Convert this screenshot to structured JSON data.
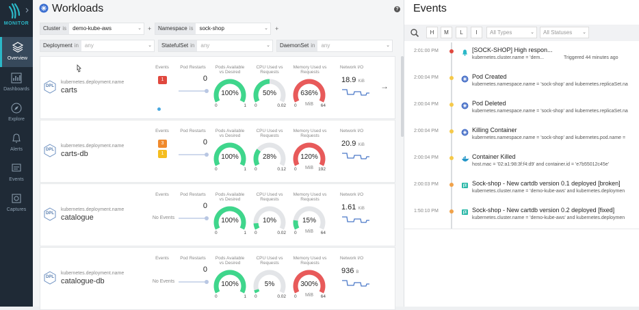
{
  "brand": {
    "label": "MONITOR",
    "accent": "#2bb8c8"
  },
  "sidebar": {
    "items": [
      {
        "label": "Overview",
        "icon": "layers-icon"
      },
      {
        "label": "Dashboards",
        "icon": "dashboard-icon"
      },
      {
        "label": "Explore",
        "icon": "compass-icon"
      },
      {
        "label": "Alerts",
        "icon": "bell-icon"
      },
      {
        "label": "Events",
        "icon": "events-icon"
      },
      {
        "label": "Captures",
        "icon": "capture-icon"
      }
    ]
  },
  "workloads": {
    "title": "Workloads",
    "help": "?",
    "filters": {
      "cluster": {
        "key": "Cluster",
        "op": "is",
        "value": "demo-kube-aws"
      },
      "namespace": {
        "key": "Namespace",
        "op": "is",
        "value": "sock-shop"
      },
      "deployment": {
        "key": "Deployment",
        "op": "in",
        "value": "any"
      },
      "statefulset": {
        "key": "StatefulSet",
        "op": "in",
        "value": "any"
      },
      "daemonset": {
        "key": "DaemonSet",
        "op": "in",
        "value": "any"
      },
      "plus": "+"
    },
    "columns": {
      "events": "Events",
      "restarts": "Pod Restarts",
      "pods": "Pods Available vs Desired",
      "cpu": "CPU Used vs Requests",
      "memory": "Memory Used vs Requests",
      "network": "Network I/O"
    },
    "cards": [
      {
        "kind_label": "kubernetes.deployment.name",
        "icon": "DPL",
        "name": "carts",
        "events": [
          {
            "count": "1",
            "color": "#e0483e"
          }
        ],
        "no_events": "",
        "restarts": "0",
        "pods": {
          "value": "100%",
          "min": "0",
          "max": "1",
          "fraction": 1.0,
          "color": "#3fd68c"
        },
        "cpu": {
          "value": "50%",
          "min": "0",
          "max": "0.02",
          "fraction": 0.5,
          "color": "#3fd68c"
        },
        "memory": {
          "value": "636%",
          "min": "0",
          "max": "64",
          "unit": "MiB",
          "fraction": 1.0,
          "color": "#e85a5a"
        },
        "network": {
          "value": "18.9",
          "unit": "KiB"
        }
      },
      {
        "kind_label": "kubernetes.deployment.name",
        "icon": "DPL",
        "name": "carts-db",
        "events": [
          {
            "count": "3",
            "color": "#f08a2c"
          },
          {
            "count": "1",
            "color": "#f5bd1f"
          }
        ],
        "no_events": "",
        "restarts": "0",
        "pods": {
          "value": "100%",
          "min": "0",
          "max": "1",
          "fraction": 1.0,
          "color": "#3fd68c"
        },
        "cpu": {
          "value": "28%",
          "min": "0",
          "max": "0.12",
          "fraction": 0.28,
          "color": "#3fd68c"
        },
        "memory": {
          "value": "120%",
          "min": "0",
          "max": "192",
          "unit": "MiB",
          "fraction": 1.0,
          "color": "#e85a5a"
        },
        "network": {
          "value": "20.9",
          "unit": "KiB"
        }
      },
      {
        "kind_label": "kubernetes.deployment.name",
        "icon": "DPL",
        "name": "catalogue",
        "events": [],
        "no_events": "No Events",
        "restarts": "0",
        "pods": {
          "value": "100%",
          "min": "0",
          "max": "1",
          "fraction": 1.0,
          "color": "#3fd68c"
        },
        "cpu": {
          "value": "10%",
          "min": "0",
          "max": "0.02",
          "fraction": 0.1,
          "color": "#3fd68c"
        },
        "memory": {
          "value": "15%",
          "min": "0",
          "max": "64",
          "unit": "MiB",
          "fraction": 0.15,
          "color": "#3fd68c"
        },
        "network": {
          "value": "1.61",
          "unit": "KiB"
        }
      },
      {
        "kind_label": "kubernetes.deployment.name",
        "icon": "DPL",
        "name": "catalogue-db",
        "events": [],
        "no_events": "No Events",
        "restarts": "0",
        "pods": {
          "value": "100%",
          "min": "0",
          "max": "1",
          "fraction": 1.0,
          "color": "#3fd68c"
        },
        "cpu": {
          "value": "5%",
          "min": "0",
          "max": "0.02",
          "fraction": 0.05,
          "color": "#3fd68c"
        },
        "memory": {
          "value": "300%",
          "min": "0",
          "max": "64",
          "unit": "MiB",
          "fraction": 1.0,
          "color": "#e85a5a"
        },
        "network": {
          "value": "936",
          "unit": "B"
        }
      }
    ],
    "expand_arrow": "→"
  },
  "events_panel": {
    "title": "Events",
    "toolbar": {
      "h": "H",
      "m": "M",
      "l": "L",
      "i": "I",
      "types": "All Types",
      "statuses": "All Statuses"
    },
    "items": [
      {
        "time": "2:01:00 PM",
        "dot": "#e0483e",
        "icon": "bell-icon",
        "icon_color": "#2bb8c8",
        "title": "[SOCK-SHOP] High respon...",
        "sub": "kubernetes.cluster.name = 'dem...",
        "extra": "Triggered 44 minutes ago"
      },
      {
        "time": "2:00:04 PM",
        "dot": "#f5c94a",
        "icon": "kubernetes-icon",
        "icon_color": "#4a72c8",
        "title": "Pod Created",
        "sub": "kubernetes.namespace.name = 'sock-shop' and kubernetes.replicaSet.na",
        "extra": ""
      },
      {
        "time": "2:00:04 PM",
        "dot": "#f5c94a",
        "icon": "kubernetes-icon",
        "icon_color": "#4a72c8",
        "title": "Pod Deleted",
        "sub": "kubernetes.namespace.name = 'sock-shop' and kubernetes.replicaSet.na",
        "extra": ""
      },
      {
        "time": "2:00:04 PM",
        "dot": "#f5c94a",
        "icon": "kubernetes-icon",
        "icon_color": "#4a72c8",
        "title": "Killing Container",
        "sub": "kubernetes.namespace.name = 'sock-shop' and kubernetes.pod.name =",
        "extra": ""
      },
      {
        "time": "2:00:04 PM",
        "dot": "#f5c94a",
        "icon": "docker-icon",
        "icon_color": "#2496c8",
        "title": "Container Killed",
        "sub": "host.mac = '02:a1:98:3f:f4:d9' and container.id = 'e7b55012c45e'",
        "extra": ""
      },
      {
        "time": "2:00:03 PM",
        "dot": "#f0a24a",
        "icon": "flag-icon",
        "icon_color": "#2bb8a8",
        "title": "Sock-shop - New cartdb version 0.1 deployed [broken]",
        "sub": "kubernetes.cluster.name = 'demo-kube-aws' and kubernetes.deploymen",
        "extra": ""
      },
      {
        "time": "1:50:10 PM",
        "dot": "#f0a24a",
        "icon": "flag-icon",
        "icon_color": "#2bb8a8",
        "title": "Sock-shop - New cartdb version 0.2 deployed [fixed]",
        "sub": "kubernetes.cluster.name = 'demo-kube-aws' and kubernetes.deploymen",
        "extra": ""
      }
    ]
  }
}
